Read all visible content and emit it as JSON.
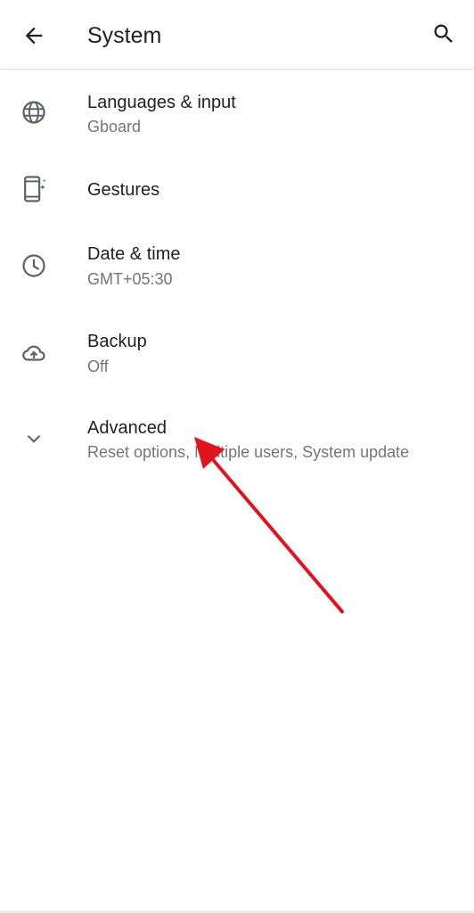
{
  "header": {
    "title": "System",
    "back_icon": "arrow-back-icon",
    "search_icon": "search-icon"
  },
  "items": [
    {
      "title": "Languages & input",
      "summary": "Gboard",
      "icon": "globe-icon"
    },
    {
      "title": "Gestures",
      "summary": "",
      "icon": "phone-gesture-icon"
    },
    {
      "title": "Date & time",
      "summary": "GMT+05:30",
      "icon": "clock-icon"
    },
    {
      "title": "Backup",
      "summary": "Off",
      "icon": "cloud-upload-icon"
    },
    {
      "title": "Advanced",
      "summary": "Reset options, Multiple users, System update",
      "icon": "chevron-down-icon"
    }
  ],
  "colors": {
    "primary_text": "#202124",
    "secondary_text": "#757575",
    "icon": "#5f6368",
    "annotation_arrow": "#e0141e"
  }
}
